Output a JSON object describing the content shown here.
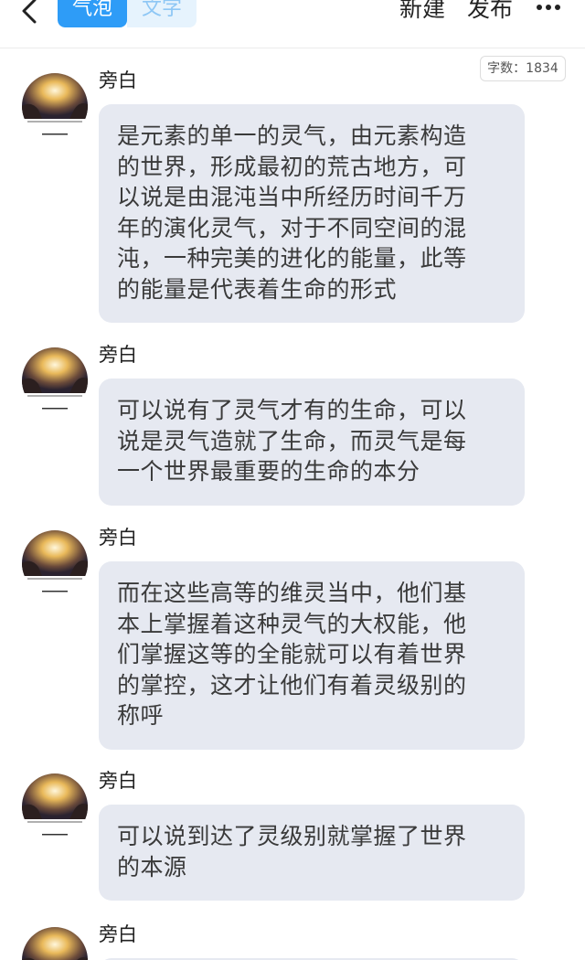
{
  "header": {
    "tabs": [
      {
        "label": "气泡",
        "active": true
      },
      {
        "label": "文字",
        "active": false
      }
    ],
    "new_label": "新建",
    "publish_label": "发布",
    "more_icon": "more-dots-icon",
    "back_icon": "chevron-left-icon"
  },
  "word_count": "字数：1834",
  "messages": [
    {
      "speaker": "旁白",
      "text": "是元素的单一的灵气，由元素构造\n的世界，形成最初的荒古地方，可\n以说是由混沌当中所经历时间千万\n年的演化灵气，对于不同空间的混\n沌，一种完美的进化的能量，此等\n的能量是代表着生命的形式"
    },
    {
      "speaker": "旁白",
      "text": "可以说有了灵气才有的生命，可以\n说是灵气造就了生命，而灵气是每\n一个世界最重要的生命的本分"
    },
    {
      "speaker": "旁白",
      "text": "而在这些高等的维灵当中，他们基\n本上掌握着这种灵气的大权能，他\n们掌握这等的全能就可以有着世界\n的掌控，这才让他们有着灵级别的\n称呼"
    },
    {
      "speaker": "旁白",
      "text": "可以说到达了灵级别就掌握了世界\n的本源"
    },
    {
      "speaker": "旁白",
      "text": ""
    }
  ],
  "colors": {
    "accent": "#2e9cf7",
    "accent_light": "#e6f3fd",
    "bubble_bg": "#e6e9f1",
    "text": "#3a3a3a"
  }
}
